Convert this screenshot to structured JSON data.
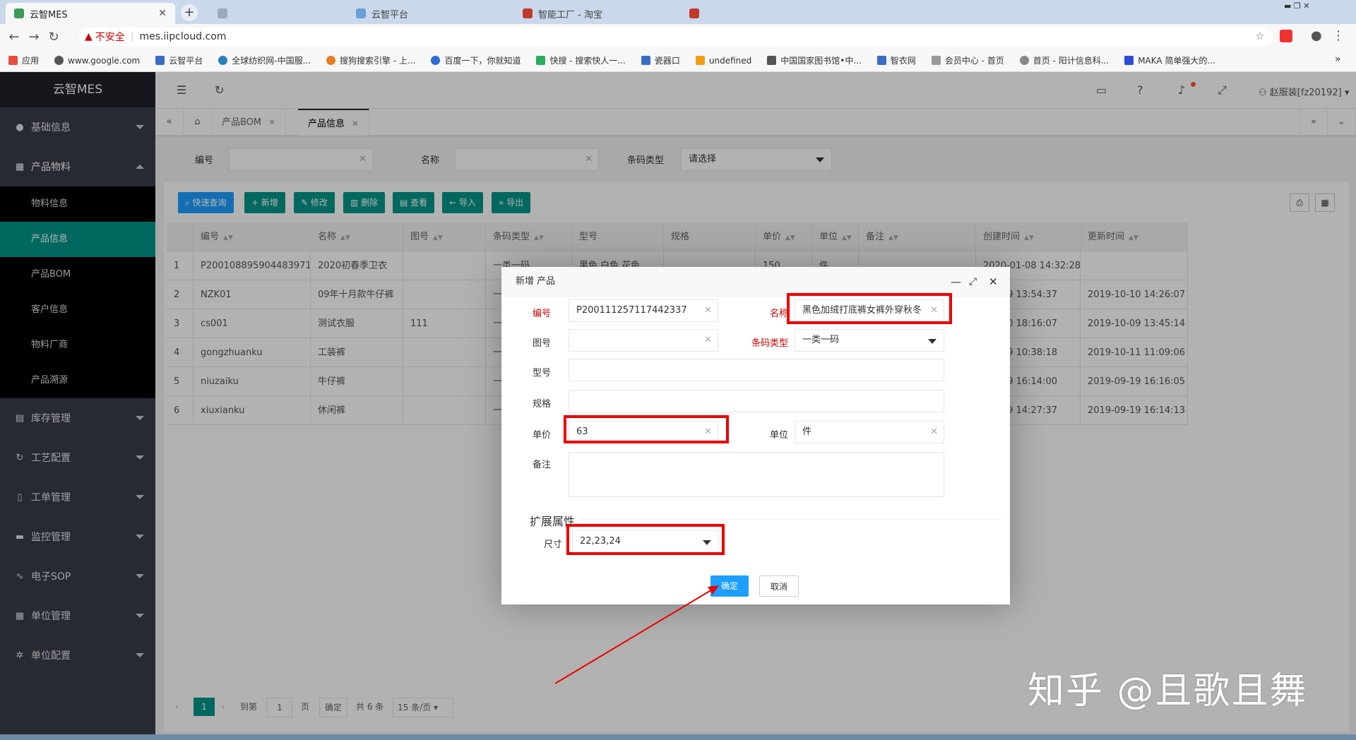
{
  "browser": {
    "tabs": [
      {
        "title": "云智MES",
        "active": true
      },
      {
        "title": "",
        "active": false
      },
      {
        "title": "云智平台",
        "active": false
      },
      {
        "title": "智能工厂 - 淘宝",
        "active": false
      },
      {
        "title": "",
        "active": false
      }
    ],
    "insecure_label": "不安全",
    "url": "mes.iipcloud.com",
    "bookmarks": [
      "应用",
      "www.google.com",
      "云智平台",
      "全球纺织网-中国服...",
      "搜狗搜索引擎 - 上...",
      "百度一下，你就知道",
      "快搜 - 搜索快人一...",
      "瓷器口",
      "undefined",
      "中国国家图书馆•中...",
      "智衣网",
      "会员中心 - 首页",
      "首页 - 阳计信息科...",
      "MAKA 简单强大的..."
    ],
    "more_bookmarks": "»"
  },
  "sidebar": {
    "logo": "云智MES",
    "menus": [
      {
        "label": "基础信息",
        "icon": "circle-icon"
      },
      {
        "label": "产品物料",
        "icon": "grid-icon",
        "expanded": true,
        "children": [
          {
            "label": "物料信息"
          },
          {
            "label": "产品信息",
            "active": true
          },
          {
            "label": "产品BOM"
          },
          {
            "label": "客户信息"
          },
          {
            "label": "物料厂商"
          },
          {
            "label": "产品溯源"
          }
        ]
      },
      {
        "label": "库存管理",
        "icon": "storage-icon"
      },
      {
        "label": "工艺配置",
        "icon": "refresh-icon"
      },
      {
        "label": "工单管理",
        "icon": "doc-icon"
      },
      {
        "label": "监控管理",
        "icon": "monitor-icon"
      },
      {
        "label": "电子SOP",
        "icon": "pulse-icon"
      },
      {
        "label": "单位管理",
        "icon": "grid-icon"
      },
      {
        "label": "单位配置",
        "icon": "gear-icon"
      }
    ]
  },
  "header": {
    "user": "赵服装[fz20192]"
  },
  "page_tabs": [
    {
      "label": "产品BOM"
    },
    {
      "label": "产品信息",
      "active": true
    }
  ],
  "search": {
    "code_label": "编号",
    "name_label": "名称",
    "barcode_label": "条码类型",
    "barcode_placeholder": "请选择"
  },
  "toolbar": {
    "quick": "快速查询",
    "add": "新增",
    "edit": "修改",
    "delete": "删除",
    "view": "查看",
    "import": "导入",
    "export": "导出"
  },
  "table": {
    "headers": [
      "编号",
      "名称",
      "图号",
      "条码类型",
      "型号",
      "规格",
      "单价",
      "单位",
      "备注",
      "创建时间",
      "更新时间"
    ],
    "rows": [
      {
        "n": "1",
        "code": "P200108895904483971",
        "name": "2020初春季卫衣",
        "drawing": "",
        "barcode": "一类一码",
        "model": "黑色,白色,花色",
        "spec": "",
        "price": "150",
        "unit": "件",
        "created": "2020-01-08 14:32:28",
        "updated": ""
      },
      {
        "n": "2",
        "code": "NZK01",
        "name": "09年十月款牛仔裤",
        "drawing": "",
        "barcode": "一",
        "model": "",
        "spec": "",
        "price": "",
        "unit": "",
        "created": "-10-09 13:54:37",
        "updated": "2019-10-10 14:26:07"
      },
      {
        "n": "3",
        "code": "cs001",
        "name": "测试衣服",
        "drawing": "111",
        "barcode": "一",
        "model": "",
        "spec": "",
        "price": "",
        "unit": "",
        "created": "-09-30 18:16:07",
        "updated": "2019-10-09 13:45:14"
      },
      {
        "n": "4",
        "code": "gongzhuanku",
        "name": "工装裤",
        "drawing": "",
        "barcode": "一",
        "model": "",
        "spec": "",
        "price": "",
        "unit": "",
        "created": "-09-29 10:38:18",
        "updated": "2019-10-11 11:09:06"
      },
      {
        "n": "5",
        "code": "niuzaiku",
        "name": "牛仔裤",
        "drawing": "",
        "barcode": "一",
        "model": "",
        "spec": "",
        "price": "",
        "unit": "",
        "created": "-09-19 16:14:00",
        "updated": "2019-09-19 16:16:05"
      },
      {
        "n": "6",
        "code": "xiuxianku",
        "name": "休闲裤",
        "drawing": "",
        "barcode": "一",
        "model": "",
        "spec": "",
        "price": "",
        "unit": "",
        "created": "-09-19 14:27:37",
        "updated": "2019-09-19 16:14:13"
      }
    ]
  },
  "pager": {
    "page": "1",
    "goto_label": "到第",
    "goto_value": "1",
    "page_label": "页",
    "confirm": "确定",
    "total": "共 6 条",
    "per_page": "15 条/页"
  },
  "dialog": {
    "title": "新增 产品",
    "code_label": "编号",
    "code_value": "P200111257117442337",
    "name_label": "名称",
    "name_value": "黑色加绒打底裤女裤外穿秋冬",
    "drawing_label": "图号",
    "drawing_value": "",
    "barcode_label": "条码类型",
    "barcode_value": "一类一码",
    "model_label": "型号",
    "spec_label": "规格",
    "price_label": "单价",
    "price_value": "63",
    "unit_label": "单位",
    "unit_value": "件",
    "remark_label": "备注",
    "ext_title": "扩展属性",
    "size_label": "尺寸",
    "size_value": "22,23,24",
    "ok": "确定",
    "cancel": "取消"
  },
  "watermark": "知乎 @且歌且舞",
  "colors": {
    "accent": "#009688",
    "sidebar": "#393d49",
    "highlight": "#e00000",
    "primary_btn": "#1e9fff"
  }
}
